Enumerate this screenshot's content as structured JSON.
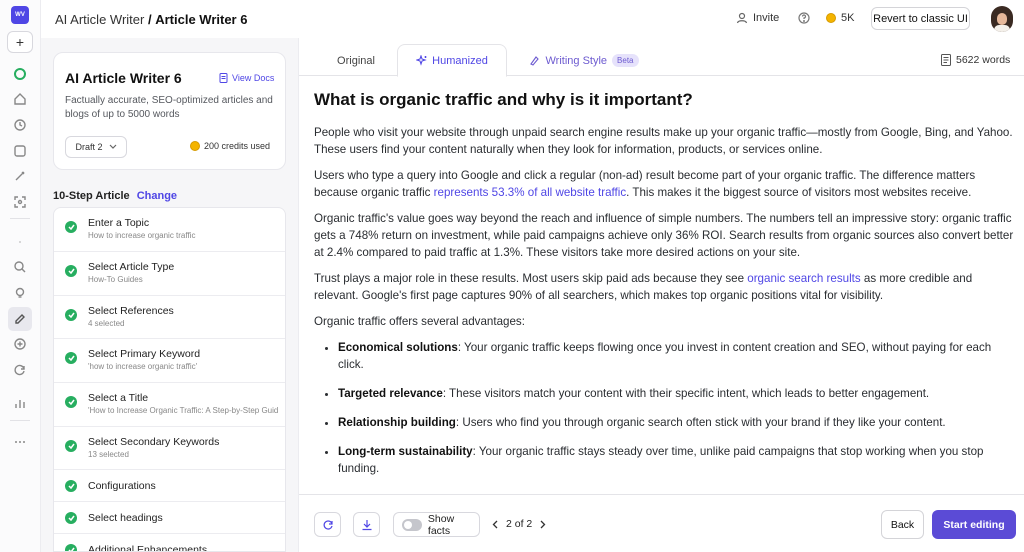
{
  "app": {
    "logo_text": "WV"
  },
  "breadcrumb": {
    "parent": "AI Article Writer",
    "separator": "/",
    "current": "Article Writer 6"
  },
  "topbar": {
    "invite_label": "Invite",
    "help_icon": "question-icon",
    "credits_balance": "5K",
    "revert_label": "Revert to classic UI"
  },
  "rail": {
    "new_label": "+"
  },
  "card": {
    "title": "AI Article Writer 6",
    "docs_label": "View Docs",
    "description": "Factually accurate, SEO-optimized articles and blogs of up to 5000 words",
    "draft_label": "Draft 2",
    "credits_used": "200 credits used"
  },
  "steps_header": {
    "label": "10-Step Article",
    "change_label": "Change"
  },
  "steps": [
    {
      "title": "Enter a Topic",
      "sub": "How to increase organic traffic"
    },
    {
      "title": "Select Article Type",
      "sub": "How-To Guides"
    },
    {
      "title": "Select References",
      "sub": "4 selected"
    },
    {
      "title": "Select Primary Keyword",
      "sub": "'how to increase organic traffic'"
    },
    {
      "title": "Select a Title",
      "sub": "'How to Increase Organic Traffic: A Step-by-Step Guide'"
    },
    {
      "title": "Select Secondary Keywords",
      "sub": "13 selected"
    },
    {
      "title": "Configurations",
      "sub": ""
    },
    {
      "title": "Select headings",
      "sub": ""
    },
    {
      "title": "Additional Enhancements",
      "sub": ""
    }
  ],
  "tabs": {
    "original": "Original",
    "humanized": "Humanized",
    "writing_style": "Writing Style",
    "beta": "Beta",
    "active": "Humanized"
  },
  "word_count": "5622 words",
  "article": {
    "heading": "What is organic traffic and why is it important?",
    "p1": "People who visit your website through unpaid search engine results make up your organic traffic—mostly from Google, Bing, and Yahoo. These users find your content naturally when they look for information, products, or services online.",
    "p2_before": "Users who type a query into Google and click a regular (non-ad) result become part of your organic traffic. The difference matters because organic traffic ",
    "p2_link": "represents 53.3% of all website traffic",
    "p2_after": ". This makes it the biggest source of visitors most websites receive.",
    "p3": "Organic traffic's value goes way beyond the reach and influence of simple numbers. The numbers tell an impressive story: organic traffic gets a 748% return on investment, while paid campaigns achieve only 36% ROI. Search results from organic sources also convert better at 2.4% compared to paid traffic at 1.3%. These visitors take more desired actions on your site.",
    "p4_before": "Trust plays a major role in these results. Most users skip paid ads because they see ",
    "p4_link": "organic search results",
    "p4_after": " as more credible and relevant. Google's first page captures 90% of all searchers, which makes top organic positions vital for visibility.",
    "p5": "Organic traffic offers several advantages:",
    "bullets": [
      {
        "bold": "Economical solutions",
        "text": ": Your organic traffic keeps flowing once you invest in content creation and SEO, without paying for each click."
      },
      {
        "bold": "Targeted relevance",
        "text": ": These visitors match your content with their specific intent, which leads to better engagement."
      },
      {
        "bold": "Relationship building",
        "text": ": Users who find you through organic search often stick with your brand if they like your content."
      },
      {
        "bold": "Long-term sustainability",
        "text": ": Your organic traffic stays steady over time, unlike paid campaigns that stop working when you stop funding."
      }
    ]
  },
  "footer": {
    "show_facts_label": "Show facts",
    "page_label": "2 of 2",
    "back_label": "Back",
    "start_label": "Start editing"
  },
  "colors": {
    "accent": "#5b4bd6",
    "link": "#4f46e5",
    "success": "#27ae60"
  }
}
